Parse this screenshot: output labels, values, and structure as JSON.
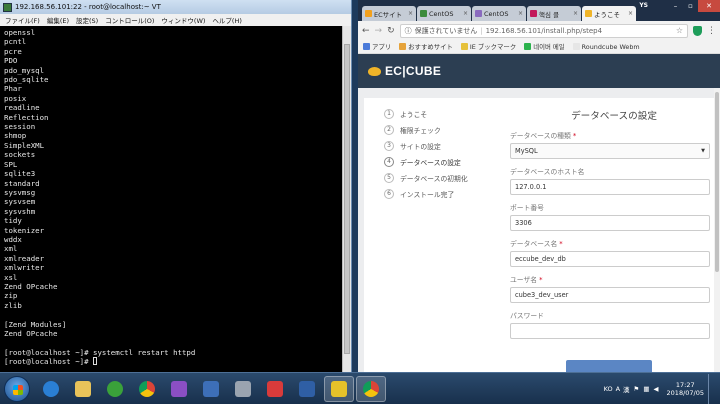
{
  "terminal": {
    "title": "192.168.56.101:22 - root@localhost:~ VT",
    "menu": [
      "ファイル(F)",
      "編集(E)",
      "設定(S)",
      "コントロール(O)",
      "ウィンドウ(W)",
      "ヘルプ(H)"
    ],
    "lines": [
      "openssl",
      "pcntl",
      "pcre",
      "PDO",
      "pdo_mysql",
      "pdo_sqlite",
      "Phar",
      "posix",
      "readline",
      "Reflection",
      "session",
      "shmop",
      "SimpleXML",
      "sockets",
      "SPL",
      "sqlite3",
      "standard",
      "sysvmsg",
      "sysvsem",
      "sysvshm",
      "tidy",
      "tokenizer",
      "wddx",
      "xml",
      "xmlreader",
      "xmlwriter",
      "xsl",
      "Zend OPcache",
      "zip",
      "zlib",
      "",
      "[Zend Modules]",
      "Zend OPcache",
      "",
      "[root@localhost ~]# systemctl restart httpd"
    ],
    "prompt": "[root@localhost ~]# "
  },
  "browser": {
    "tabs": [
      {
        "label": "ECサイト",
        "color": "#f3a11d",
        "active": false
      },
      {
        "label": "CentOS",
        "color": "#3b8b3b",
        "active": false
      },
      {
        "label": "CentOS",
        "color": "#8a6bbf",
        "active": false
      },
      {
        "label": "핵심 클",
        "color": "#c2185b",
        "active": false
      },
      {
        "label": "ようこそ",
        "color": "#f0b428",
        "active": true
      }
    ],
    "profile": "YS",
    "omnibox": {
      "insecure_label": "保護されていません",
      "url": "192.168.56.101/install.php/step4"
    },
    "bookmarks": [
      {
        "label": "アプリ",
        "color": "#4a7ad9"
      },
      {
        "label": "おすすめサイト",
        "color": "#e6a33a"
      },
      {
        "label": "IE ブックマーク",
        "color": "#e6c13a"
      },
      {
        "label": "네이버 메일",
        "color": "#2bb24c"
      },
      {
        "label": "Roundcube Webm",
        "color": "#e6e6e6"
      }
    ]
  },
  "eccube": {
    "logo": "EC|CUBE",
    "steps": [
      {
        "num": "1",
        "label": "ようこそ"
      },
      {
        "num": "2",
        "label": "権限チェック"
      },
      {
        "num": "3",
        "label": "サイトの設定"
      },
      {
        "num": "4",
        "label": "データベースの設定"
      },
      {
        "num": "5",
        "label": "データベースの初期化"
      },
      {
        "num": "6",
        "label": "インストール完了"
      }
    ],
    "form": {
      "title": "データベースの設定",
      "db_type_label": "データベースの種類",
      "db_type_value": "MySQL",
      "db_host_label": "データベースのホスト名",
      "db_host_value": "127.0.0.1",
      "db_port_label": "ポート番号",
      "db_port_value": "3306",
      "db_name_label": "データベース名",
      "db_name_value": "eccube_dev_db",
      "db_user_label": "ユーザ名",
      "db_user_value": "cube3_dev_user",
      "db_pass_label": "パスワード",
      "db_pass_value": "",
      "required_mark": "*"
    }
  },
  "taskbar": {
    "ime": [
      "KO",
      "A",
      "漢"
    ],
    "time": "17:27",
    "date": "2018/07/05"
  }
}
